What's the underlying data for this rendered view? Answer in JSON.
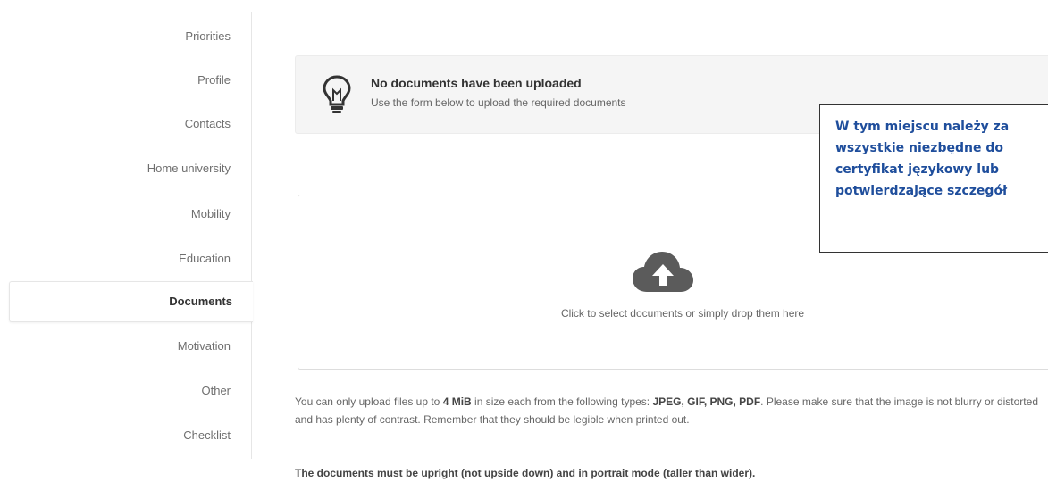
{
  "sidebar": {
    "items": [
      {
        "label": "Priorities"
      },
      {
        "label": "Profile"
      },
      {
        "label": "Contacts"
      },
      {
        "label": "Home university"
      },
      {
        "label": "Mobility"
      },
      {
        "label": "Education"
      },
      {
        "label": "Documents",
        "active": true
      },
      {
        "label": "Motivation"
      },
      {
        "label": "Other"
      },
      {
        "label": "Checklist"
      }
    ]
  },
  "alert": {
    "icon": "lightbulb-icon",
    "title": "No documents have been uploaded",
    "text": "Use the form below to upload the required documents"
  },
  "dropzone": {
    "icon": "cloud-upload-icon",
    "text": "Click to select documents or simply drop them here"
  },
  "callout": {
    "lines": [
      "W tym miejscu należy za",
      "wszystkie niezbędne do",
      "certyfikat językowy lub",
      "potwierdzające szczegół"
    ],
    "color": "#1f4e9c"
  },
  "info": {
    "p1_a": "You can only upload files up to ",
    "p1_size": "4 MiB",
    "p1_b": " in size each from the following types: ",
    "p1_types": "JPEG, GIF, PNG, PDF",
    "p1_c": ". Please make sure that the image is not blurry or distorted and has plenty of contrast. Remember that they should be legible when printed out.",
    "p2": "The documents must be upright (not upside down) and in portrait mode (taller than wider)."
  }
}
